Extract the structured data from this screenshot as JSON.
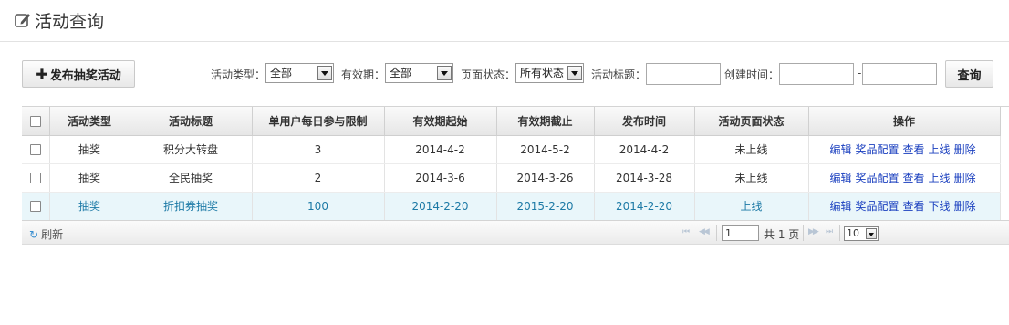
{
  "page": {
    "title": "活动查询"
  },
  "toolbar": {
    "add_button": "发布抽奖活动",
    "activity_type": {
      "label": "活动类型：",
      "value": "全部"
    },
    "validity": {
      "label": "有效期：",
      "value": "全部"
    },
    "page_status": {
      "label": "页面状态：",
      "value": "所有状态"
    },
    "activity_title": {
      "label": "活动标题：",
      "value": ""
    },
    "create_time": {
      "label": "创建时间：",
      "separator": "-",
      "start": "",
      "end": ""
    },
    "query_button": "查询"
  },
  "table": {
    "headers": [
      "活动类型",
      "活动标题",
      "单用户每日参与限制",
      "有效期起始",
      "有效期截止",
      "发布时间",
      "活动页面状态",
      "操作"
    ],
    "rows": [
      {
        "type": "抽奖",
        "title": "积分大转盘",
        "limit": "3",
        "start": "2014-4-2",
        "end": "2014-5-2",
        "publish": "2014-4-2",
        "status": "未上线",
        "ops": [
          "编辑",
          "奖品配置",
          "查看",
          "上线",
          "删除"
        ],
        "selected": false
      },
      {
        "type": "抽奖",
        "title": "全民抽奖",
        "limit": "2",
        "start": "2014-3-6",
        "end": "2014-3-26",
        "publish": "2014-3-28",
        "status": "未上线",
        "ops": [
          "编辑",
          "奖品配置",
          "查看",
          "上线",
          "删除"
        ],
        "selected": false
      },
      {
        "type": "抽奖",
        "title": "折扣券抽奖",
        "limit": "100",
        "start": "2014-2-20",
        "end": "2015-2-20",
        "publish": "2014-2-20",
        "status": "上线",
        "ops": [
          "编辑",
          "奖品配置",
          "查看",
          "下线",
          "删除"
        ],
        "selected": true
      }
    ]
  },
  "pager": {
    "refresh": "刷新",
    "page_input": "1",
    "total": "共 1 页",
    "page_size": "10",
    "first": "⏮",
    "prev": "◀◀",
    "next": "▶▶",
    "last": "⏭"
  }
}
